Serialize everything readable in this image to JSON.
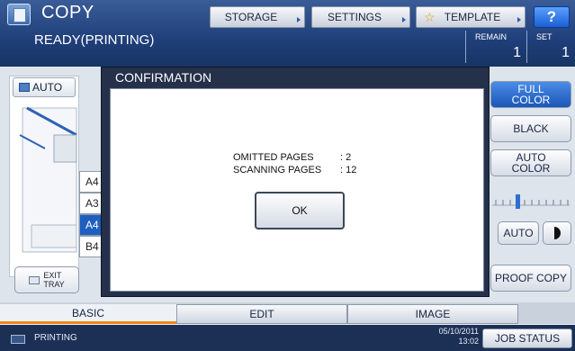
{
  "header": {
    "title": "COPY",
    "status": "READY(PRINTING)",
    "buttons": {
      "storage": "STORAGE",
      "settings": "SETTINGS",
      "template": "TEMPLATE",
      "help": "?"
    },
    "remain_label": "REMAIN",
    "remain_value": "1",
    "set_label": "SET",
    "set_value": "1"
  },
  "left_panel": {
    "auto_label": "AUTO",
    "paper_sizes": [
      "A4",
      "A3",
      "A4",
      "B4"
    ],
    "selected_paper_index": 2,
    "exit_tray_label_1": "EXIT",
    "exit_tray_label_2": "TRAY"
  },
  "right_panel": {
    "full_color_1": "FULL",
    "full_color_2": "COLOR",
    "black": "BLACK",
    "auto_color_1": "AUTO",
    "auto_color_2": "COLOR",
    "density_auto": "AUTO",
    "proof_copy": "PROOF COPY"
  },
  "dialog": {
    "title": "CONFIRMATION",
    "omitted_label": "OMITTED PAGES",
    "omitted_value": ": 2",
    "scanning_label": "SCANNING PAGES",
    "scanning_value": ": 12",
    "ok_label": "OK"
  },
  "tabs": {
    "basic": "BASIC",
    "edit": "EDIT",
    "image": "IMAGE"
  },
  "statusbar": {
    "text": "PRINTING",
    "date": "05/10/2011",
    "time": "13:02",
    "job_status": "JOB STATUS"
  },
  "colors": {
    "header": "#1f3f7a",
    "accent": "#f08a1c",
    "selected": "#1e5fbf"
  }
}
